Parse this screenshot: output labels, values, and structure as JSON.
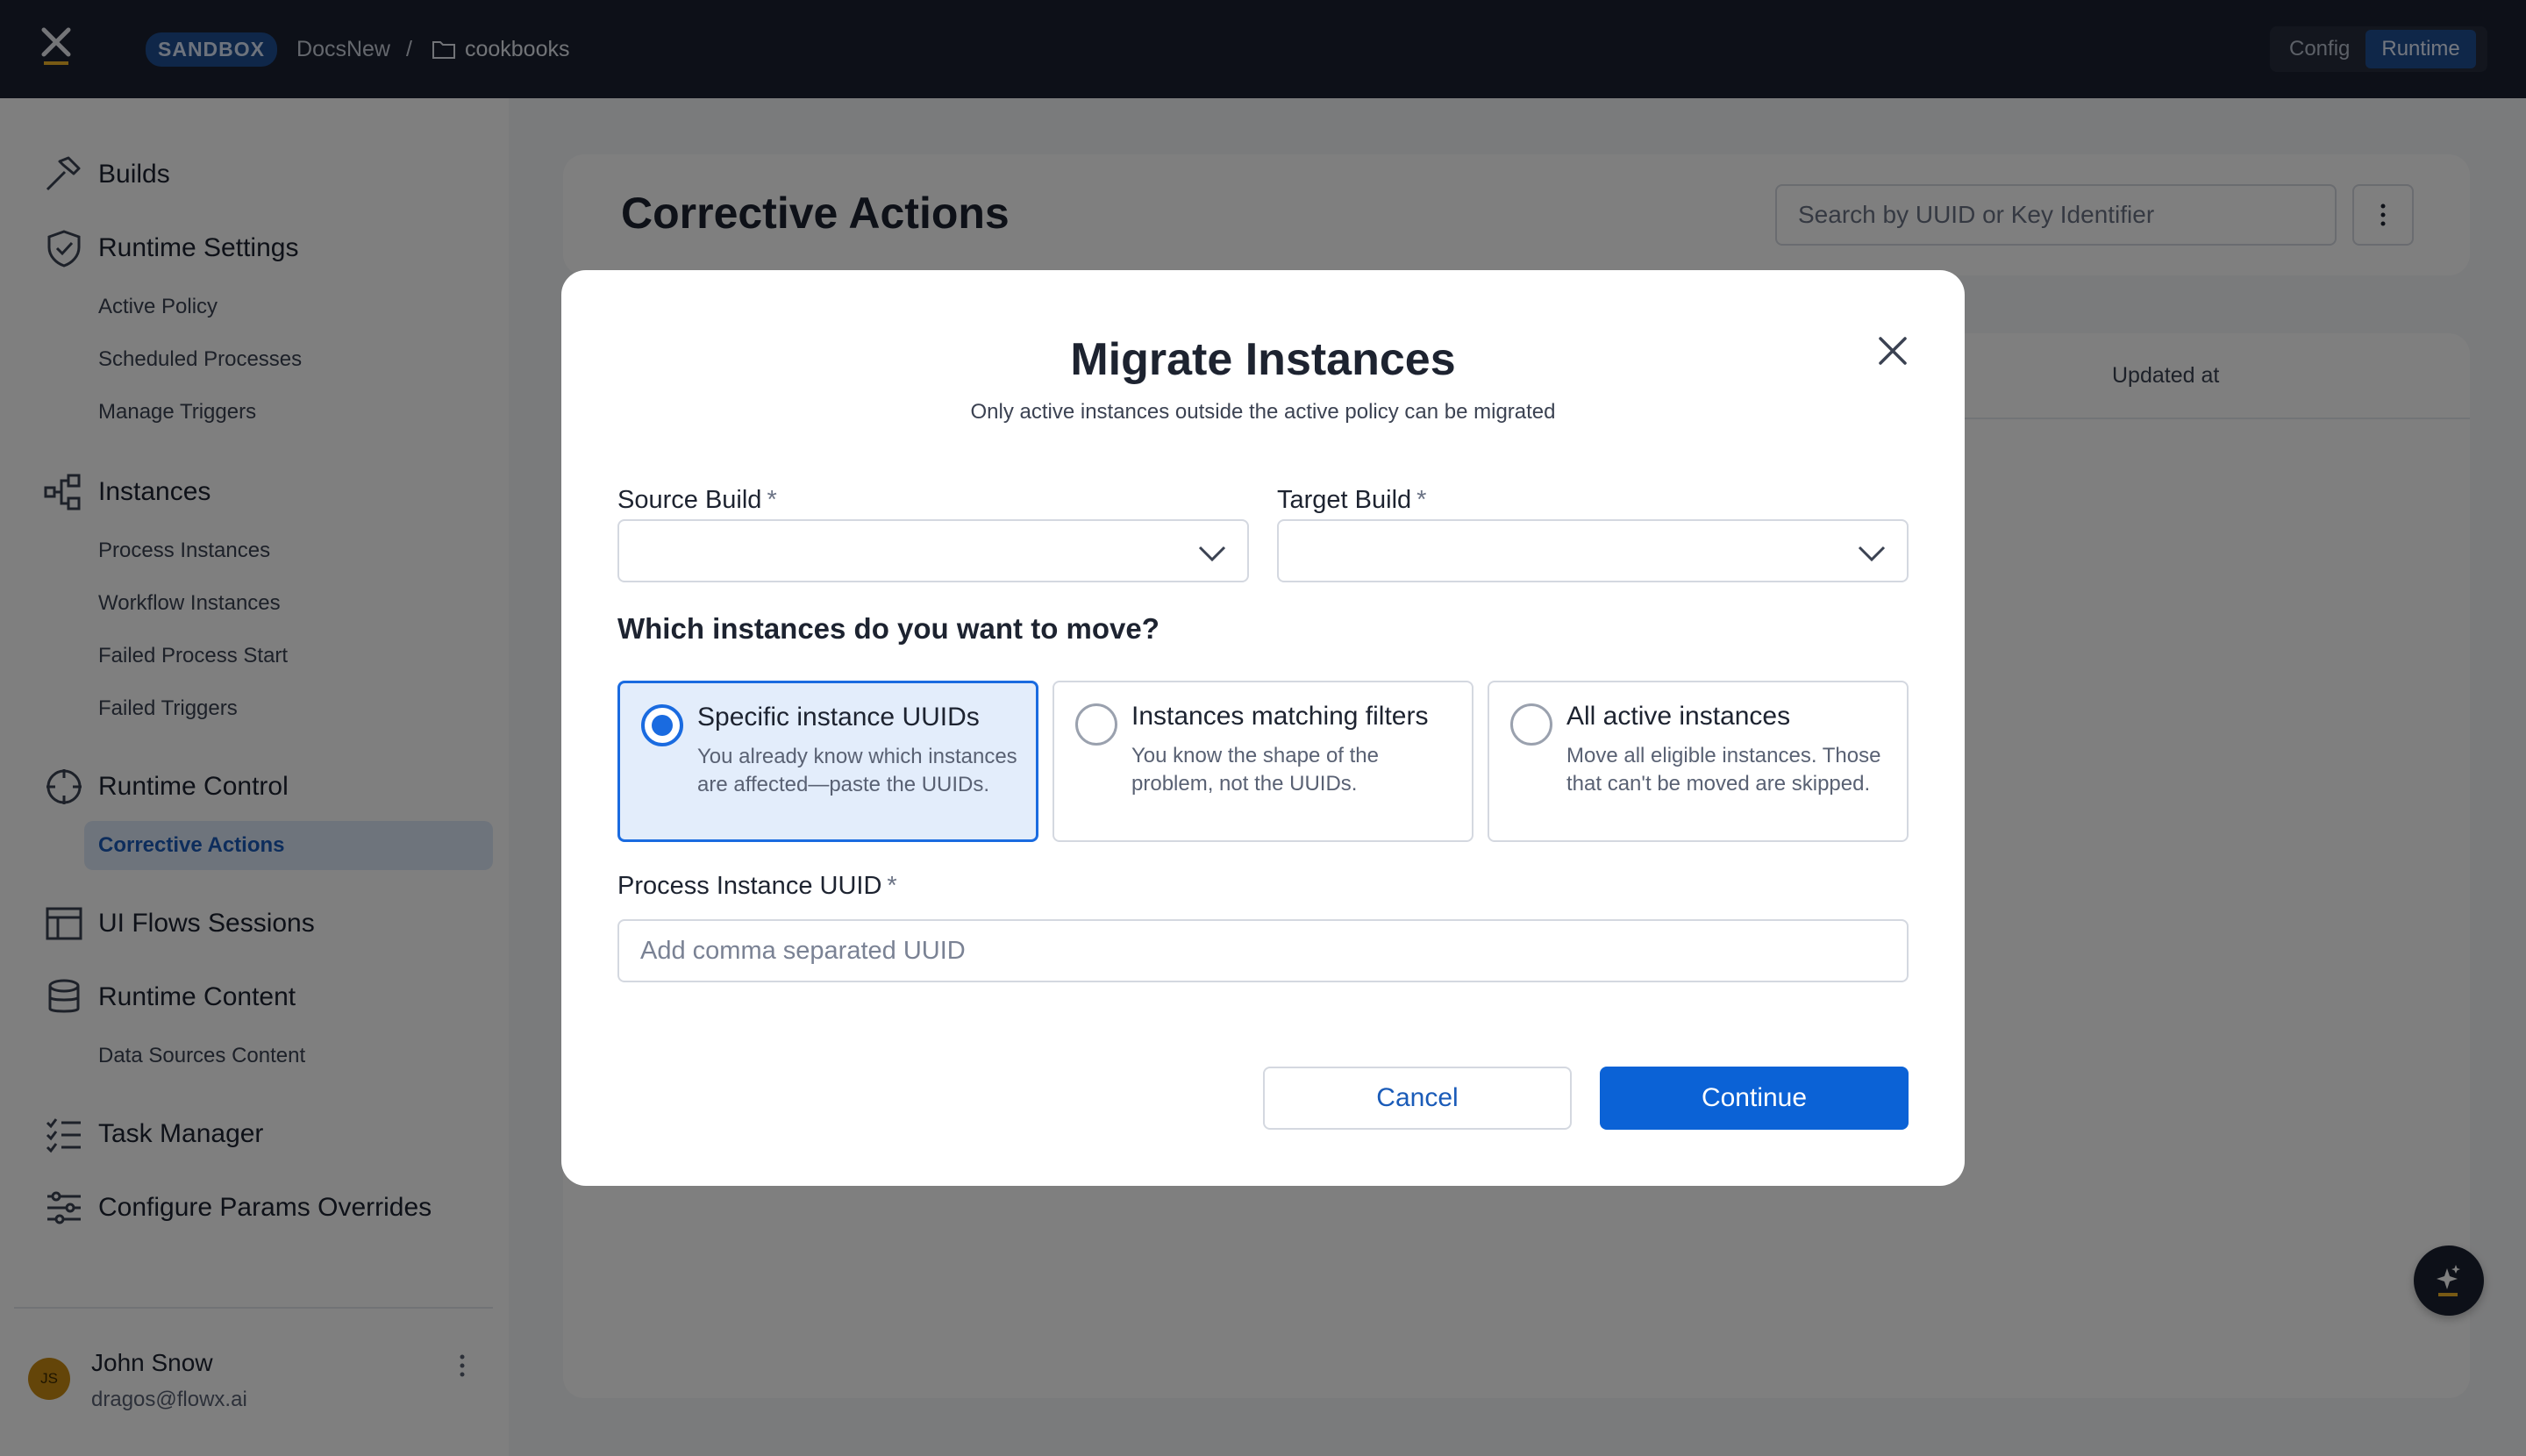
{
  "topbar": {
    "env_badge": "SANDBOX",
    "project": "DocsNew",
    "separator": "/",
    "folder": "cookbooks",
    "modes": [
      "Config",
      "Runtime"
    ],
    "active_mode": "Runtime"
  },
  "sidebar": {
    "builds": "Builds",
    "runtime_settings": "Runtime Settings",
    "active_policy": "Active Policy",
    "scheduled_processes": "Scheduled Processes",
    "manage_triggers": "Manage Triggers",
    "instances": "Instances",
    "process_instances": "Process Instances",
    "workflow_instances": "Workflow Instances",
    "failed_process_start": "Failed Process Start",
    "failed_triggers": "Failed Triggers",
    "runtime_control": "Runtime Control",
    "corrective_actions": "Corrective Actions",
    "ui_flows_sessions": "UI Flows Sessions",
    "runtime_content": "Runtime Content",
    "data_sources_content": "Data Sources Content",
    "task_manager": "Task Manager",
    "configure_params_overrides": "Configure Params Overrides",
    "user": {
      "initials": "JS",
      "name": "John Snow",
      "email": "dragos@flowx.ai"
    }
  },
  "page": {
    "title": "Corrective Actions",
    "search_placeholder": "Search by UUID or Key Identifier",
    "columns": {
      "updated_at": "Updated at"
    }
  },
  "modal": {
    "title": "Migrate Instances",
    "subtitle": "Only active instances outside the active policy can be migrated",
    "source_build_label": "Source Build",
    "target_build_label": "Target Build",
    "required_mark": "*",
    "question": "Which instances do you want to move?",
    "options": [
      {
        "title": "Specific instance UUIDs",
        "desc": "You already know which instances are affected—paste the UUIDs.",
        "selected": true
      },
      {
        "title": "Instances matching filters",
        "desc": "You know the shape of the problem, not the UUIDs.",
        "selected": false
      },
      {
        "title": "All active instances",
        "desc": "Move all eligible instances. Those that can't be moved are skipped.",
        "selected": false
      }
    ],
    "uuid_label": "Process Instance UUID",
    "uuid_placeholder": "Add comma separated UUID",
    "cancel": "Cancel",
    "continue": "Continue"
  },
  "colors": {
    "topbar": "#1b2130",
    "accent": "#0b62d6",
    "active_nav_bg": "#dde8f8",
    "env_badge": "#1f4f93"
  }
}
